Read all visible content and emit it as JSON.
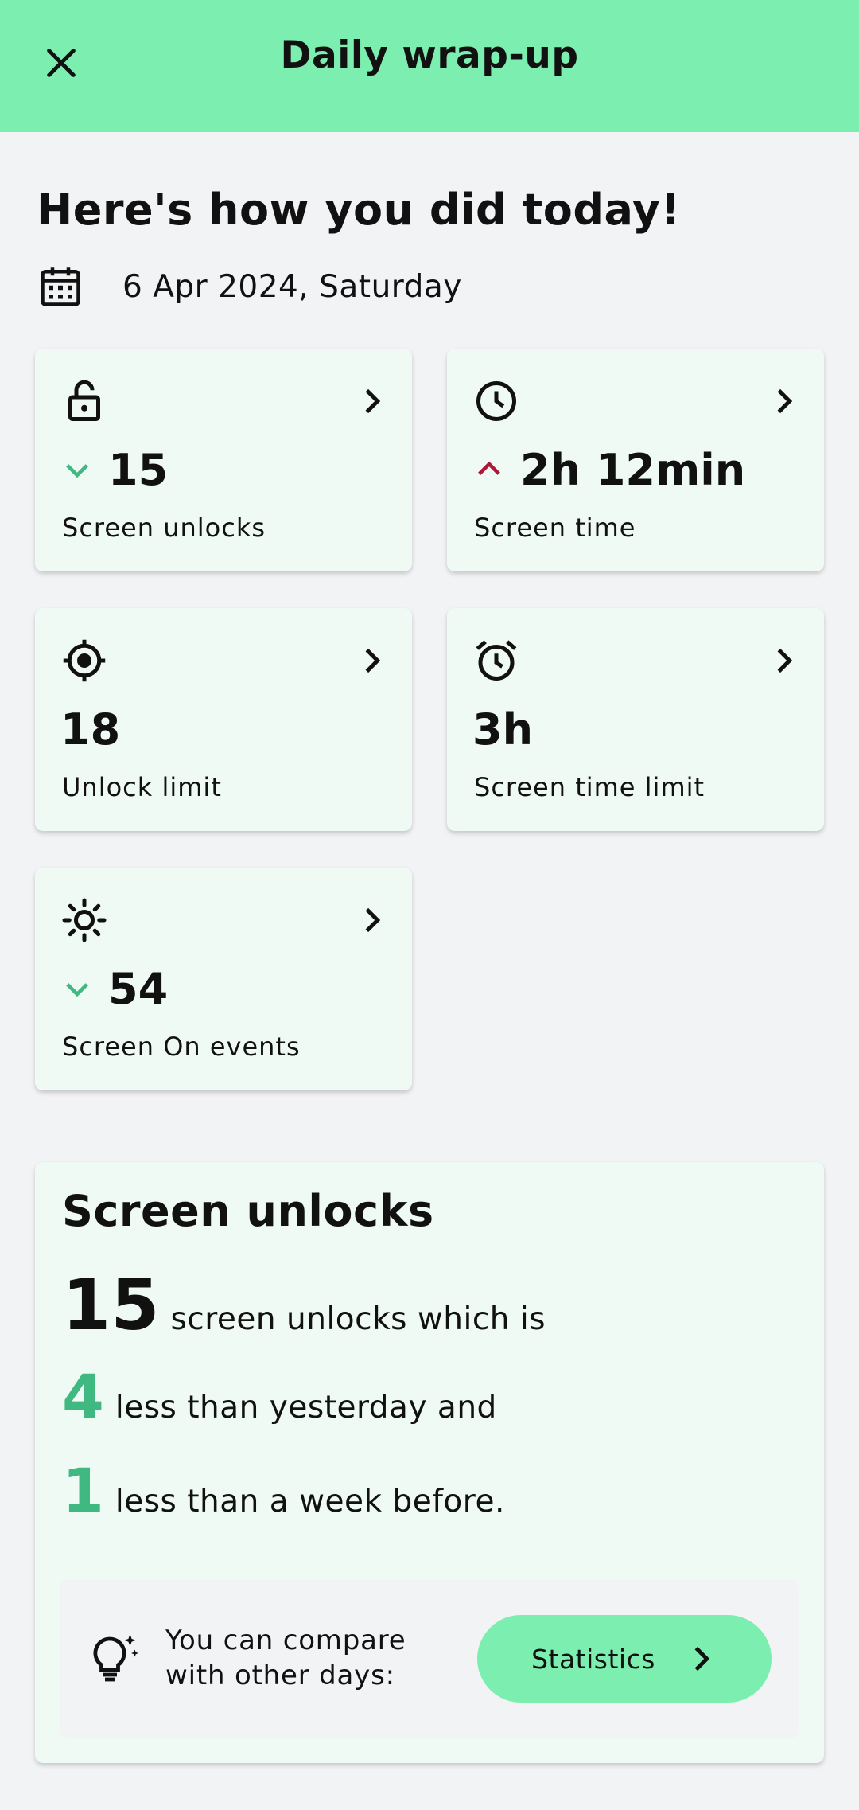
{
  "header": {
    "title": "Daily wrap-up"
  },
  "headline": "Here's how you did today!",
  "date": "6 Apr 2024, Saturday",
  "cards": [
    {
      "value": "15",
      "label": "Screen unlocks",
      "trend": "down",
      "icon": "lock-open-icon"
    },
    {
      "value": "2h 12min",
      "label": "Screen time",
      "trend": "up",
      "icon": "clock-icon"
    },
    {
      "value": "18",
      "label": "Unlock limit",
      "trend": "none",
      "icon": "target-icon"
    },
    {
      "value": "3h",
      "label": "Screen time limit",
      "trend": "none",
      "icon": "alarm-icon"
    },
    {
      "value": "54",
      "label": "Screen On events",
      "trend": "down",
      "icon": "sun-icon"
    }
  ],
  "colors": {
    "accent": "#7ceeb0",
    "trend_down": "#3fb881",
    "trend_up": "#b0163a",
    "card_bg": "#f0faf4",
    "page_bg": "#f2f3f5"
  },
  "summary": {
    "title": "Screen unlocks",
    "total": "15",
    "total_text": "screen unlocks which is",
    "diff_yesterday": "4",
    "diff_yesterday_text": "less than yesterday and",
    "diff_week": "1",
    "diff_week_text": "less than a week before.",
    "tip_line1": "You can compare",
    "tip_line2": "with other days:",
    "button_label": "Statistics"
  }
}
